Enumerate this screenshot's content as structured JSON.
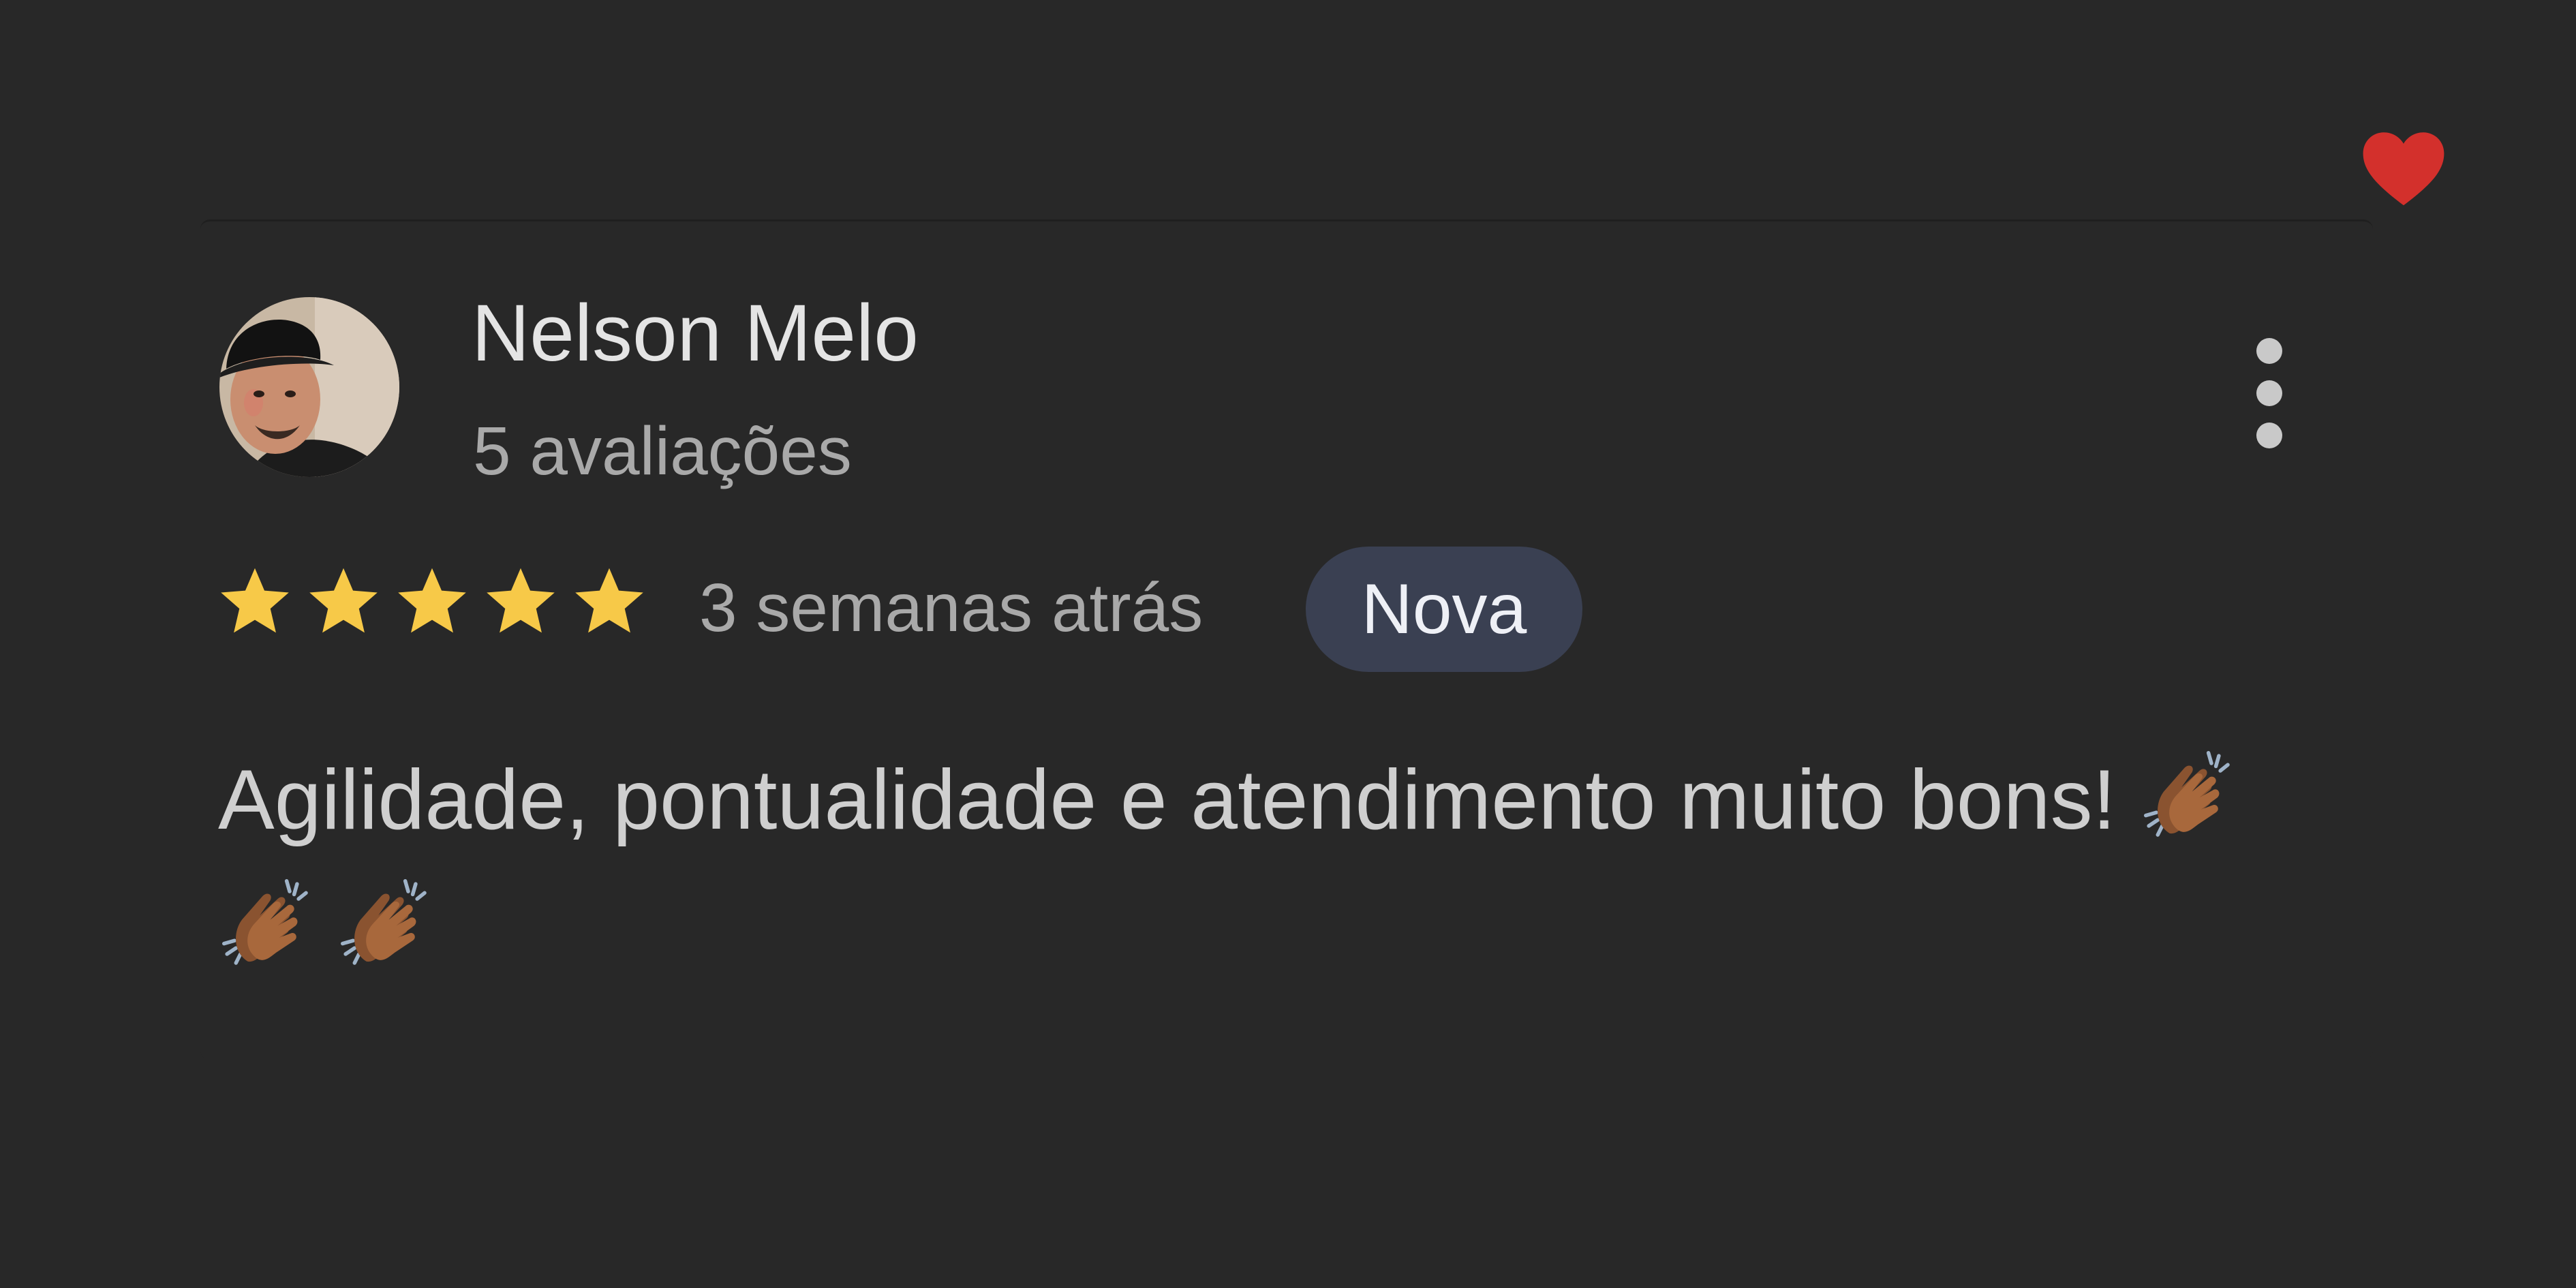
{
  "review": {
    "reviewer_name": "Nelson Melo",
    "review_count": "5 avaliações",
    "rating": 5,
    "rating_max": 5,
    "time_ago": "3 semanas atrás",
    "badge": "Nova",
    "text": "Agilidade, pontualidade e atendimento muito bons!",
    "emoji_count": 3
  },
  "icons": {
    "heart": "heart-icon",
    "more": "more-vertical-icon",
    "star": "star-icon",
    "clap": "clapping-hands-emoji"
  },
  "colors": {
    "background": "#282828",
    "heart": "#d3302c",
    "star": "#f7c948",
    "badge_bg": "#3a4052"
  }
}
